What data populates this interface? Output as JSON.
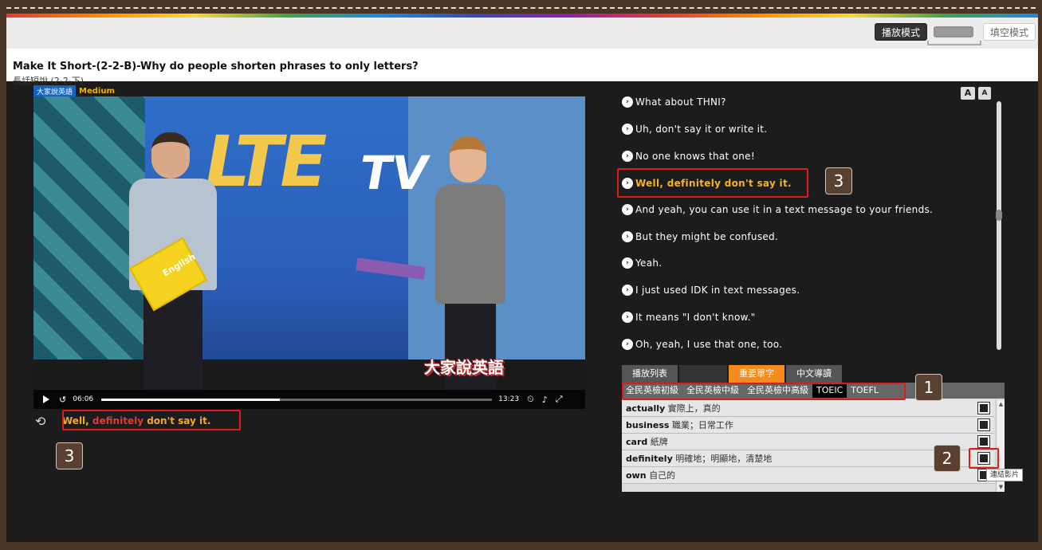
{
  "header": {
    "mode_play": "播放模式",
    "mode_fill": "填空模式",
    "title": "Make It Short-(2-2-B)-Why do people shorten phrases to only letters?",
    "subtitle": "長話短說 (2-2-下)"
  },
  "video": {
    "series_badge": "大家說英語",
    "level_badge": "Medium",
    "show_logo": "大家說英語",
    "lte": "LTE",
    "tv": "TV",
    "book": "English",
    "time_current": "06:06",
    "time_total": "13:23",
    "progress_fraction": 0.456
  },
  "caption": {
    "before": "Well, ",
    "highlight": "definitely",
    "after": " don't say it."
  },
  "font_controls": {
    "large": "A",
    "small": "A"
  },
  "transcript": {
    "lines": [
      "What about THNI?",
      "Uh, don't say it or write it.",
      "No one knows that one!",
      "Well, definitely don't say it.",
      "And yeah, you can use it in a text message to your friends.",
      "But they might be confused.",
      "Yeah.",
      "I just used IDK in text messages.",
      "It means \"I don't know.\"",
      "Oh, yeah, I use that one, too."
    ],
    "active_index": 3
  },
  "tabs": [
    "播放列表",
    "",
    "重要單字",
    "中文導讀"
  ],
  "level_tabs": [
    "全民英檢初級",
    "全民英檢中級",
    "全民英檢中高級",
    "TOEIC",
    "TOEFL"
  ],
  "vocab": [
    {
      "word": "actually",
      "meaning": "實際上，真的"
    },
    {
      "word": "business",
      "meaning": "職業；日常工作"
    },
    {
      "word": "card",
      "meaning": "紙牌"
    },
    {
      "word": "definitely",
      "meaning": "明確地；明顯地，清楚地"
    },
    {
      "word": "own",
      "meaning": "自己的"
    }
  ],
  "tooltip": "連結影片",
  "annotations": [
    "1",
    "2",
    "3",
    "3"
  ],
  "colors": {
    "accent": "#f58a1f",
    "highlight": "#f5b423",
    "annotation_red": "#e01b1b"
  }
}
